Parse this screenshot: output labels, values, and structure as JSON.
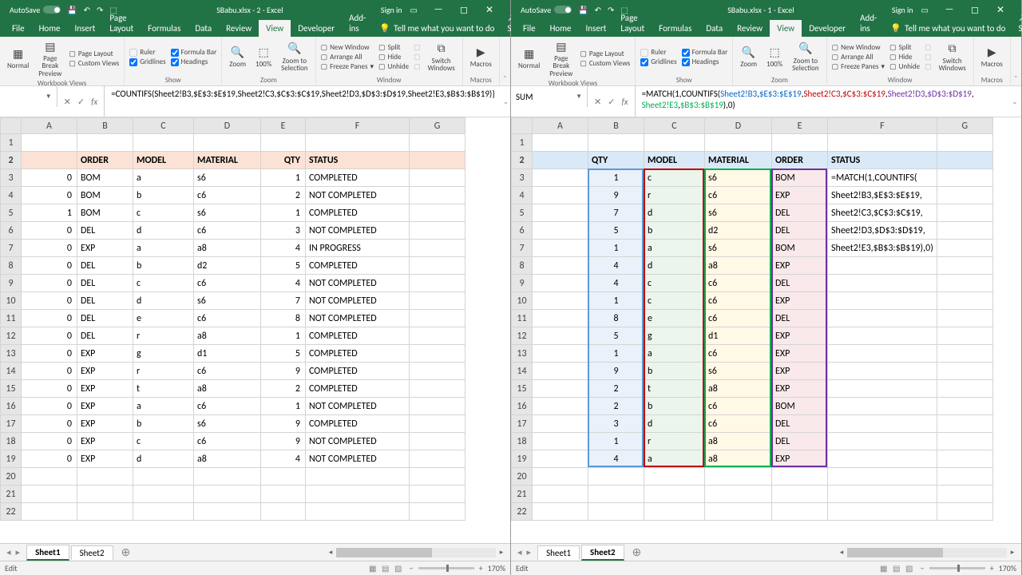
{
  "left": {
    "title": "SBabu.xlsx - 2 - Excel",
    "autosave": "AutoSave",
    "signin": "Sign in",
    "tabs": [
      "File",
      "Home",
      "Insert",
      "Page Layout",
      "Formulas",
      "Data",
      "Review",
      "View",
      "Developer",
      "Add-ins"
    ],
    "tell": "Tell me what you want to do",
    "share": "Share",
    "ribbon": {
      "views": [
        "Normal",
        "Page Break Preview",
        "Page Layout",
        "Custom Views"
      ],
      "views_label": "Workbook Views",
      "show_checks": [
        [
          "Ruler",
          "Formula Bar"
        ],
        [
          "Gridlines",
          "Headings"
        ]
      ],
      "show_label": "Show",
      "zoom": [
        "Zoom",
        "100%",
        "Zoom to Selection"
      ],
      "zoom_label": "Zoom",
      "window_left": [
        "New Window",
        "Arrange All",
        "Freeze Panes"
      ],
      "window_right": [
        "Split",
        "Hide",
        "Unhide"
      ],
      "switch": "Switch Windows",
      "window_label": "Window",
      "macros": "Macros",
      "macros_label": "Macros"
    },
    "name_box": "",
    "formula": "=COUNTIFS(Sheet2!B3,$E$3:$E$19,Sheet2!C3,$C$3:$C$19,Sheet2!D3,$D$3:$D$19,Sheet2!E3,$B$3:$B$19)}",
    "cols": [
      "A",
      "B",
      "C",
      "D",
      "E",
      "F",
      "G"
    ],
    "headers": [
      "",
      "ORDER",
      "MODEL",
      "MATERIAL",
      "QTY",
      "STATUS"
    ],
    "rows": [
      [
        "0",
        "BOM",
        "a",
        "s6",
        "1",
        "COMPLETED"
      ],
      [
        "0",
        "BOM",
        "b",
        "c6",
        "2",
        "NOT COMPLETED"
      ],
      [
        "1",
        "BOM",
        "c",
        "s6",
        "1",
        "COMPLETED"
      ],
      [
        "0",
        "DEL",
        "d",
        "c6",
        "3",
        "NOT COMPLETED"
      ],
      [
        "0",
        "EXP",
        "a",
        "a8",
        "4",
        "IN PROGRESS"
      ],
      [
        "0",
        "DEL",
        "b",
        "d2",
        "5",
        "COMPLETED"
      ],
      [
        "0",
        "DEL",
        "c",
        "c6",
        "4",
        "NOT COMPLETED"
      ],
      [
        "0",
        "DEL",
        "d",
        "s6",
        "7",
        "NOT COMPLETED"
      ],
      [
        "0",
        "DEL",
        "e",
        "c6",
        "8",
        "NOT COMPLETED"
      ],
      [
        "0",
        "DEL",
        "r",
        "a8",
        "1",
        "COMPLETED"
      ],
      [
        "0",
        "EXP",
        "g",
        "d1",
        "5",
        "COMPLETED"
      ],
      [
        "0",
        "EXP",
        "r",
        "c6",
        "9",
        "COMPLETED"
      ],
      [
        "0",
        "EXP",
        "t",
        "a8",
        "2",
        "COMPLETED"
      ],
      [
        "0",
        "EXP",
        "a",
        "c6",
        "1",
        "NOT COMPLETED"
      ],
      [
        "0",
        "EXP",
        "b",
        "s6",
        "9",
        "COMPLETED"
      ],
      [
        "0",
        "EXP",
        "c",
        "c6",
        "9",
        "NOT COMPLETED"
      ],
      [
        "0",
        "EXP",
        "d",
        "a8",
        "4",
        "NOT COMPLETED"
      ]
    ],
    "sheets": [
      "Sheet1",
      "Sheet2"
    ],
    "active_sheet": 0,
    "status": "Edit",
    "zoom_pct": "170%"
  },
  "right": {
    "title": "SBabu.xlsx - 1 - Excel",
    "autosave": "AutoSave",
    "signin": "Sign in",
    "tabs": [
      "File",
      "Home",
      "Insert",
      "Page Layout",
      "Formulas",
      "Data",
      "Review",
      "View",
      "Developer",
      "Add-ins"
    ],
    "tell": "Tell me what you want to do",
    "share": "Share",
    "name_box": "SUM",
    "formula_parts": {
      "p1": "=MATCH(1,COUNTIFS(",
      "a1": "Sheet2!B3",
      "c": ",",
      "r1": "$E$3:$E$19",
      "a2": "Sheet2!C3",
      "r2": "$C$3:$C$19",
      "a3": "Sheet2!D3",
      "r3": "$D$3:$D$19",
      "a4": "Sheet2!E3",
      "r4": "$B$3:$B$19",
      "tail": "),0)"
    },
    "cols": [
      "A",
      "B",
      "C",
      "D",
      "E",
      "F",
      "G"
    ],
    "headers": [
      "QTY",
      "MODEL",
      "MATERIAL",
      "ORDER",
      "STATUS"
    ],
    "rows": [
      [
        "1",
        "c",
        "s6",
        "BOM"
      ],
      [
        "9",
        "r",
        "c6",
        "EXP"
      ],
      [
        "7",
        "d",
        "s6",
        "DEL"
      ],
      [
        "5",
        "b",
        "d2",
        "DEL"
      ],
      [
        "1",
        "a",
        "s6",
        "BOM"
      ],
      [
        "4",
        "d",
        "a8",
        "EXP"
      ],
      [
        "4",
        "c",
        "c6",
        "DEL"
      ],
      [
        "1",
        "c",
        "c6",
        "EXP"
      ],
      [
        "8",
        "e",
        "c6",
        "DEL"
      ],
      [
        "5",
        "g",
        "d1",
        "EXP"
      ],
      [
        "1",
        "a",
        "c6",
        "EXP"
      ],
      [
        "9",
        "b",
        "s6",
        "EXP"
      ],
      [
        "2",
        "t",
        "a8",
        "EXP"
      ],
      [
        "2",
        "b",
        "c6",
        "BOM"
      ],
      [
        "3",
        "d",
        "c6",
        "DEL"
      ],
      [
        "1",
        "r",
        "a8",
        "DEL"
      ],
      [
        "4",
        "a",
        "a8",
        "EXP"
      ]
    ],
    "edit_cell": {
      "l1": "=MATCH(1,COUNTIFS(",
      "l2": "Sheet2!B3,$E$3:$E$19,",
      "l3": "Sheet2!C3,$C$3:$C$19,",
      "l4": "Sheet2!D3,$D$3:$D$19,",
      "l5": "Sheet2!E3,$B$3:$B$19),0)"
    },
    "sheets": [
      "Sheet1",
      "Sheet2"
    ],
    "active_sheet": 1,
    "status": "Edit",
    "zoom_pct": "170%"
  },
  "colors": {
    "blue_border": "#5b9bd5",
    "red_border": "#c00000",
    "green_border": "#00b050",
    "purple_border": "#7030a0"
  }
}
